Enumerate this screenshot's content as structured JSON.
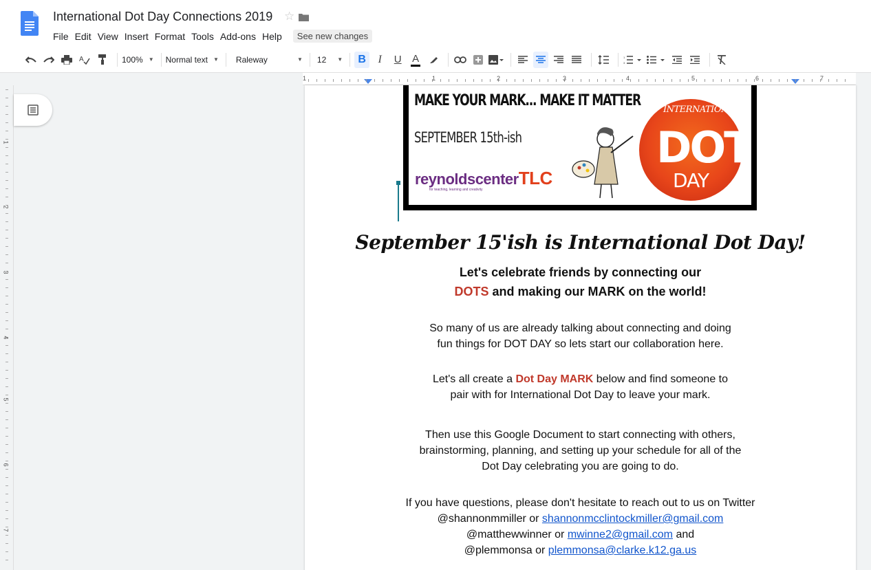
{
  "header": {
    "title": "International Dot Day Connections 2019",
    "menu": [
      "File",
      "Edit",
      "View",
      "Insert",
      "Format",
      "Tools",
      "Add-ons",
      "Help"
    ],
    "new_changes": "See new changes"
  },
  "toolbar": {
    "zoom": "100%",
    "style": "Normal text",
    "font": "Raleway",
    "size": "12",
    "bold": "B",
    "italic": "I",
    "underline": "U",
    "text_color": "A",
    "icons": [
      "undo-icon",
      "redo-icon",
      "print-icon",
      "spellcheck-icon",
      "paint-format-icon",
      "highlight-icon",
      "link-icon",
      "comment-icon",
      "image-icon",
      "align-left-icon",
      "align-center-icon",
      "align-right-icon",
      "align-justify-icon",
      "line-spacing-icon",
      "numbered-list-icon",
      "bulleted-list-icon",
      "decrease-indent-icon",
      "increase-indent-icon",
      "clear-formatting-icon"
    ]
  },
  "ruler": {
    "h_numbers": [
      "1",
      "1",
      "2",
      "3",
      "4",
      "5",
      "6",
      "7"
    ],
    "v_numbers": [
      "1",
      "2",
      "3",
      "4",
      "5",
      "6",
      "7"
    ]
  },
  "banner": {
    "line1": "MAKE YOUR MARK... MAKE IT MATTER",
    "line2": "SEPTEMBER 15th-ish",
    "brand": "reynoldscenter",
    "brand_suffix": "TLC",
    "brand_tag": "for teaching, learning and creativity",
    "dot_intl": "INTERNATIONAL",
    "dot_big": "DOT",
    "dot_day": "DAY"
  },
  "document": {
    "headline": "September 15'ish is International Dot Day!",
    "sub1": "Let's celebrate friends by connecting our",
    "sub2_red": "DOTS",
    "sub2_rest": " and making our MARK on the world!",
    "p1_a": "So many of us are already talking about connecting and doing",
    "p1_b": "fun things for DOT DAY so lets start our collaboration here.",
    "p2_a_pre": "Let's all create a ",
    "p2_a_red": "Dot Day MARK",
    "p2_a_post": " below and find someone to",
    "p2_b": "pair with for International Dot Day to leave your mark.",
    "p3_a": "Then use this Google Document to start connecting with others,",
    "p3_b": "brainstorming, planning, and setting up your schedule for all of the",
    "p3_c": "Dot Day celebrating you are going to do.",
    "p4_a": "If you have questions, please don't hesitate to reach out to us on Twitter",
    "p4_b_pre": "@shannonmmiller or ",
    "p4_b_link": "shannonmcclintockmiller@gmail.com",
    "p4_c_pre": "@matthewwinner or ",
    "p4_c_link": "mwinne2@gmail.com",
    "p4_c_post": " and",
    "p4_d_pre": "@plemmonsa or ",
    "p4_d_link": "plemmonsa@clarke.k12.ga.us"
  },
  "colors": {
    "accent": "#1a73e8",
    "red": "#c0392b",
    "link": "#1155cc"
  }
}
